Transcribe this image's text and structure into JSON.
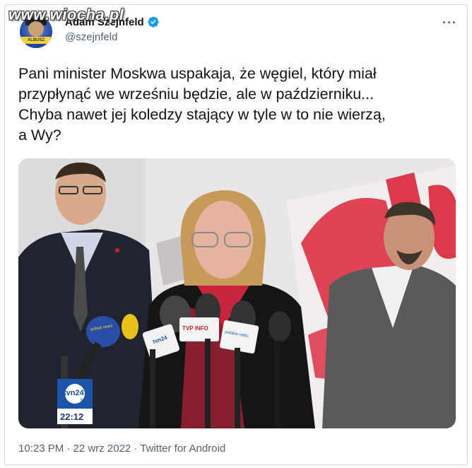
{
  "watermark": {
    "text": "www.wiocha.pl"
  },
  "author": {
    "display_name": "Adam Szejnfeld",
    "handle": "@szejnfeld",
    "avatar_banner": "ALBUSZ",
    "verified_color": "#1d9bf0"
  },
  "tweet": {
    "text": "Pani minister Moskwa uspakaja, że węgiel, który miał\nprzypłynąć we wrześniu będzie, ale w październiku...\nChyba nawet jej  koledzy stający w tyle w to nie wierzą,\na Wy?"
  },
  "media": {
    "channel_logo": "tvn24",
    "channel_sub": "HD",
    "clock": "22:12",
    "mic_labels": [
      "polsat news",
      "tvn24",
      "TVP INFO",
      "polskie radio"
    ]
  },
  "meta": {
    "text": "10:23 PM · 22 wrz 2022 · Twitter for Android"
  },
  "colors": {
    "text": "#0f1419",
    "secondary": "#536471",
    "border": "#cfd9de"
  }
}
